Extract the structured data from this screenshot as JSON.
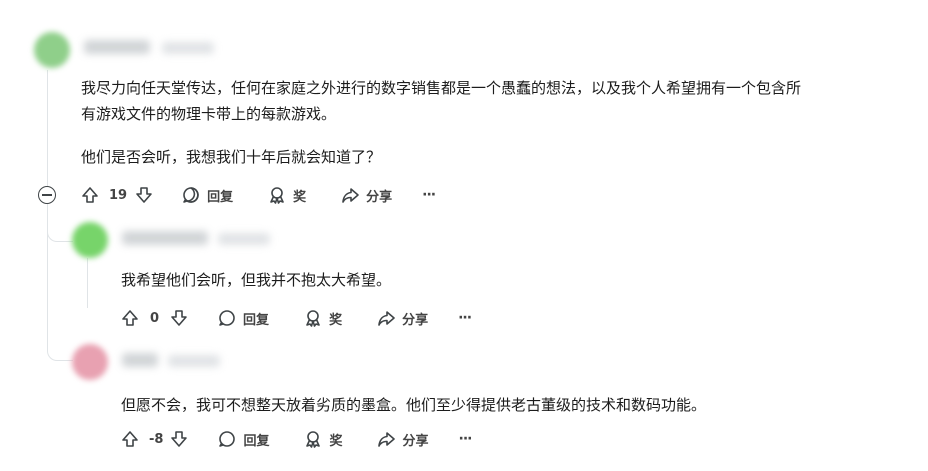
{
  "comments": [
    {
      "lines": [
        "我尽力向任天堂传达，任何在家庭之外进行的数字销售都是一个愚蠢的想法，以及我个人希望拥有一个包含所",
        "有游戏文件的物理卡带上的每款游戏。"
      ],
      "paragraph2": "他们是否会听，我想我们十年后就会知道了？",
      "votes": "19",
      "reply_label": "回复",
      "award_label": "奖",
      "share_label": "分享",
      "more_label": "···"
    },
    {
      "text": "我希望他们会听，但我并不抱太大希望。",
      "votes": "0",
      "reply_label": "回复",
      "award_label": "奖",
      "share_label": "分享",
      "more_label": "···"
    },
    {
      "text": "但愿不会，我可不想整天放着劣质的墨盒。他们至少得提供老古董级的技术和数码功能。",
      "votes": "-8",
      "reply_label": "回复",
      "award_label": "奖",
      "share_label": "分享",
      "more_label": "···"
    }
  ],
  "colors": {
    "avatar_1": "#8fcf8a",
    "avatar_2": "#77d46a",
    "avatar_3": "#e8a1b1",
    "text": "#1c1c1c",
    "thread_line": "#e0e4e7"
  },
  "icons": [
    "upvote-icon",
    "downvote-icon",
    "comment-icon",
    "award-icon",
    "share-icon",
    "more-icon",
    "collapse-icon"
  ]
}
